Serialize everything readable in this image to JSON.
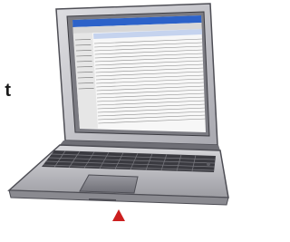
{
  "fragment_text": "t",
  "colors": {
    "arrow": "#cc1f1f",
    "body_silver": "#c9c9cc",
    "body_dark": "#8f8f95",
    "screen_bg": "#ffffff",
    "titlebar": "#2c62c9"
  },
  "icons": {
    "laptop": "laptop-icon",
    "pointer": "triangle-up-icon"
  }
}
